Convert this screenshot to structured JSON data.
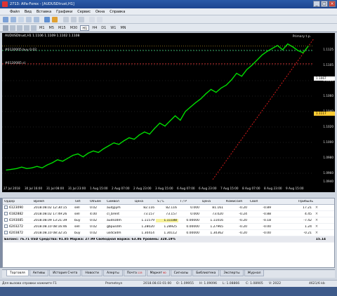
{
  "window": {
    "title": "2713: Alfa-Forex - [AUDUSDtrust,H1]"
  },
  "menu": [
    "Файл",
    "Вид",
    "Вставка",
    "Графики",
    "Сервис",
    "Окна",
    "Справка"
  ],
  "timeframes": [
    "M1",
    "M5",
    "M15",
    "M30",
    "H1",
    "H4",
    "D1",
    "W1",
    "MN"
  ],
  "active_timeframe": "H1",
  "chart": {
    "ohlc": "AUDUSDtrust,H1  1.1106 1.1109 1.1102 1.1108",
    "order_labels": [
      "#6120005 buy 0.02",
      "#6120085 sl"
    ],
    "primary_label": "Primary t.p.",
    "y_ticks": [
      "1.1125",
      "1.1105",
      "1.1085",
      "1.1060",
      "1.1040",
      "1.1020",
      "1.1000",
      "1.0980",
      "1.0960",
      "1.0940"
    ],
    "current_price": "1.1117",
    "current_price2": "1.1067",
    "x_ticks": [
      "27 Jul 2018",
      "30 Jul 16:00",
      "31 Jul 08:00",
      "31 Jul 23:00",
      "1 Aug 15:00",
      "2 Aug 07:00",
      "2 Aug 23:00",
      "3 Aug 15:00",
      "6 Aug 07:00",
      "6 Aug 23:00",
      "7 Aug 15:00",
      "8 Aug 07:00",
      "8 Aug 23:00",
      "9 Aug 15:00"
    ],
    "colors": {
      "price": "#00dd00",
      "background": "#000000",
      "trend": "#d11a1a",
      "accent": "#ffcc33"
    },
    "chart_data": {
      "type": "line",
      "series": [
        {
          "values": [
            1.0948,
            1.0949,
            1.095,
            1.0952,
            1.095,
            1.0951,
            1.0953,
            1.0951,
            1.0955,
            1.0958,
            1.0962,
            1.096,
            1.0964,
            1.0968,
            1.097,
            1.0966,
            1.0971,
            1.0974,
            1.0972,
            1.0977,
            1.0981,
            1.0985,
            1.0983,
            1.0988,
            1.0992,
            1.099,
            1.0996,
            1.1,
            1.0997,
            1.1005,
            1.1012,
            1.1008,
            1.1015,
            1.1022,
            1.1016,
            1.1028,
            1.1034,
            1.104,
            1.1045,
            1.1052,
            1.1058,
            1.1054,
            1.106,
            1.1064,
            1.1071,
            1.108,
            1.1076,
            1.1085,
            1.1091,
            1.1098,
            1.1105,
            1.111,
            1.1114,
            1.1118,
            1.1112,
            1.112,
            1.1116,
            1.1111,
            1.1108,
            1.1117
          ]
        }
      ],
      "ylim": [
        1.0935,
        1.1135
      ]
    }
  },
  "table": {
    "headers": [
      "Ордер",
      "Время",
      "Тип",
      "Объём",
      "Символ",
      "Цена",
      "S / L",
      "T / P",
      "Цена",
      "Комиссия",
      "Своп",
      "Прибыль"
    ],
    "rows": [
      [
        "6123090",
        "2018.08.02 12:30:15",
        "sell",
        "0.02",
        "audjpym",
        "82.116",
        "82.116",
        "0.000",
        "81.161",
        "-0.20",
        "-0.89",
        "17.21"
      ],
      [
        "6182882",
        "2018.08.02 17:49:26",
        "sell",
        "4.00",
        "cl_brent",
        "73.157",
        "73.157",
        "0.000",
        "73.020",
        "-0.24",
        "-0.88",
        "4.45"
      ],
      [
        "6193085",
        "2018.08.09 13:21:39",
        "buy",
        "0.02",
        "audnzdm",
        "1.11579",
        "1.11188",
        "0.00000",
        "1.11016",
        "-0.20",
        "-0.18",
        "-7.42"
      ],
      [
        "6203272",
        "2018.08.10 08:16:46",
        "sell",
        "0.02",
        "gbpusdm",
        "1.28020",
        "1.28925",
        "0.00000",
        "1.27965",
        "-0.20",
        "-0.00",
        "1.24"
      ],
      [
        "6203872",
        "2018.08.10 08:32:35",
        "buy",
        "0.02",
        "usdcadm",
        "1.30414",
        "1.30112",
        "0.00000",
        "1.30362",
        "-0.20",
        "-0.00",
        "-0.21"
      ]
    ],
    "summary": "Баланс: 76.71 USD  Средства: 91.85  Маржа: 27.99  Свободная маржа: 63.86  Уровень: 328.19%",
    "summary_total": "15.14"
  },
  "tabs": [
    {
      "label": "Торговля",
      "badge": ""
    },
    {
      "label": "Активы",
      "badge": ""
    },
    {
      "label": "История Счета",
      "badge": ""
    },
    {
      "label": "Новости",
      "badge": ""
    },
    {
      "label": "Алерты",
      "badge": ""
    },
    {
      "label": "Почта",
      "badge": "115"
    },
    {
      "label": "Маркет",
      "badge": "60"
    },
    {
      "label": "Сигналы",
      "badge": ""
    },
    {
      "label": "Библиотека",
      "badge": ""
    },
    {
      "label": "Эксперты",
      "badge": ""
    },
    {
      "label": "Журнал",
      "badge": ""
    }
  ],
  "status": {
    "help": "Для вызова справки нажмите F1",
    "profile": "Prometeyn",
    "datetime": "2018.08.03 01:00",
    "open": "O: 1.09955",
    "high": "H: 1.09096",
    "low": "L: 1.08866",
    "close": "C: 1.08905",
    "volume": "V: 2022",
    "traffic": "4621/6 kb"
  }
}
